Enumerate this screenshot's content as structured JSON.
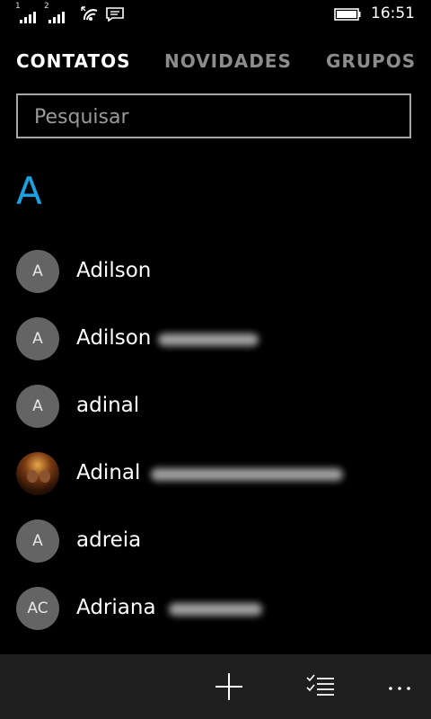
{
  "status_bar": {
    "sim1_label": "1",
    "sim2_label": "2",
    "time": "16:51",
    "icons": [
      "signal-icon",
      "signal-icon",
      "wifi-icon",
      "message-icon",
      "battery-icon"
    ]
  },
  "tabs": [
    {
      "label": "CONTATOS",
      "active": true
    },
    {
      "label": "NOVIDADES",
      "active": false
    },
    {
      "label": "GRUPOS",
      "active": false
    }
  ],
  "search": {
    "placeholder": "Pesquisar",
    "value": ""
  },
  "group": {
    "letter": "A"
  },
  "contacts": [
    {
      "initials": "A",
      "name": "Adilson",
      "has_photo": false
    },
    {
      "initials": "A",
      "name": "Adilson",
      "has_photo": false
    },
    {
      "initials": "A",
      "name": "adinal",
      "has_photo": false
    },
    {
      "initials": "",
      "name": "Adinal",
      "has_photo": true
    },
    {
      "initials": "A",
      "name": "adreia",
      "has_photo": false
    },
    {
      "initials": "AC",
      "name": "Adriana",
      "has_photo": false
    }
  ],
  "app_bar": {
    "buttons": [
      "add-icon",
      "select-list-icon",
      "more-icon"
    ]
  },
  "colors": {
    "accent": "#1ba1e2",
    "background": "#000000",
    "appbar": "#1f1f1f",
    "avatar": "#646464"
  }
}
